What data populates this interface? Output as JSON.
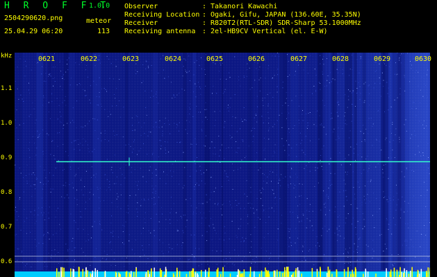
{
  "header": {
    "app_title": "H R O F F T",
    "version": "1.0.0",
    "filename": "2504290620.png",
    "datetime": "25.04.29 06:20",
    "meteor_label": "meteor",
    "meteor_count": "113"
  },
  "meta": [
    {
      "key": "Observer",
      "sep": ":",
      "value": "Takanori Kawachi"
    },
    {
      "key": "Receiving Location",
      "sep": ":",
      "value": "Ogaki, Gifu, JAPAN (136.60E, 35.35N)"
    },
    {
      "key": "Receiver",
      "sep": ":",
      "value": "R820T2(RTL-SDR) SDR-Sharp 53.1000MHz"
    },
    {
      "key": "Receiving antenna",
      "sep": ":",
      "value": "2el-HB9CV Vertical (el. E-W)"
    }
  ],
  "axis": {
    "y_unit": "kHz",
    "y_ticks": [
      "1.1",
      "1.0",
      "0.9",
      "0.8",
      "0.7",
      "0.6"
    ],
    "x_ticks": [
      "0621",
      "0622",
      "0623",
      "0624",
      "0625",
      "0626",
      "0627",
      "0628",
      "0629",
      "0630"
    ]
  },
  "signal": {
    "frequency_khz": 0.885,
    "color": "#33ffcc"
  }
}
